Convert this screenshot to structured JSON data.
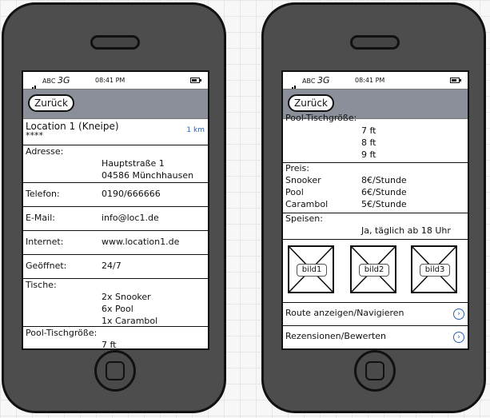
{
  "status": {
    "carrier": "ABC",
    "network": "3G",
    "time": "08:41 PM"
  },
  "nav": {
    "back_label": "Zurück"
  },
  "left": {
    "title": "Location 1 (Kneipe)",
    "rating": "****",
    "distance": "1 km",
    "address_label": "Adresse:",
    "address_line1": "Hauptstraße 1",
    "address_line2": "04586 Münchhausen",
    "phone_label": "Telefon:",
    "phone_value": "0190/666666",
    "email_label": "E-Mail:",
    "email_value": "info@loc1.de",
    "internet_label": "Internet:",
    "internet_value": "www.location1.de",
    "hours_label": "Geöffnet:",
    "hours_value": "24/7",
    "tables_label": "Tische:",
    "tables": [
      "2x Snooker",
      "6x Pool",
      "1x Carambol"
    ],
    "pool_size_label": "Pool-Tischgröße:",
    "pool_sizes": [
      "7 ft"
    ]
  },
  "right": {
    "pool_size_label": "Pool-Tischgröße:",
    "pool_sizes": [
      "7 ft",
      "8 ft",
      "9 ft"
    ],
    "price_label": "Preis:",
    "prices": [
      {
        "name": "Snooker",
        "price": "8€/Stunde"
      },
      {
        "name": "Pool",
        "price": "6€/Stunde"
      },
      {
        "name": "Carambol",
        "price": "5€/Stunde"
      }
    ],
    "food_label": "Speisen:",
    "food_value": "Ja, täglich ab 18 Uhr",
    "images": [
      "bild1",
      "bild2",
      "bild3"
    ],
    "route_link": "Route anzeigen/Navigieren",
    "reviews_link": "Rezensionen/Bewerten"
  }
}
